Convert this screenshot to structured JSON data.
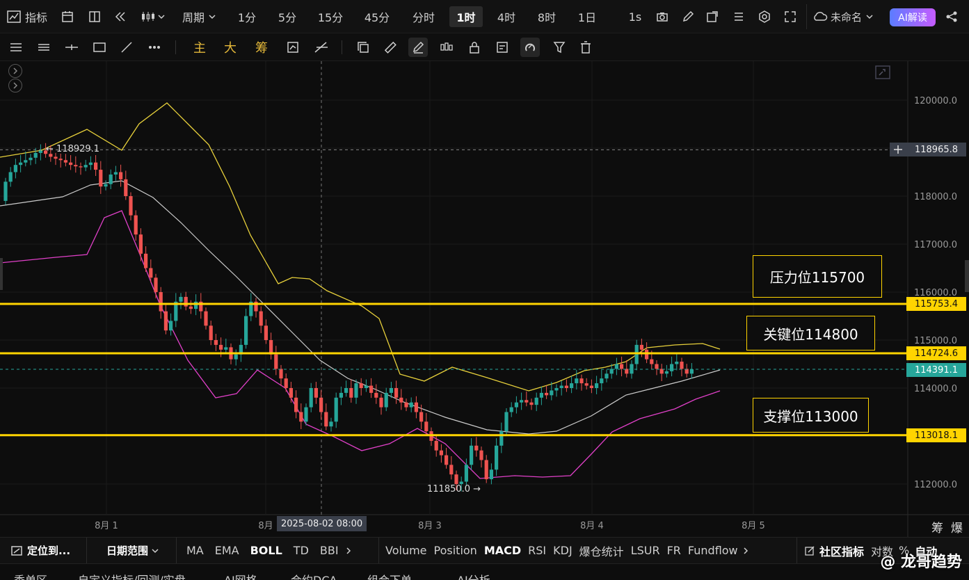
{
  "topbar": {
    "indicator_label": "指标",
    "period_label": "周期",
    "timeframes": [
      "1分",
      "5分",
      "15分",
      "45分",
      "分时",
      "1时",
      "4时",
      "8时",
      "1日"
    ],
    "active_timeframe": "1时",
    "interval_1s": "1s",
    "layout_name": "未命名",
    "ai_button": "AI解读"
  },
  "toolbar2": {
    "main_label": "主",
    "big_label": "大",
    "chip_label": "筹"
  },
  "chart": {
    "price_ticks": [
      "120000.0",
      "119000.0",
      "118000.0",
      "117000.0",
      "116000.0",
      "115000.0",
      "114000.0",
      "113000.0",
      "112000.0"
    ],
    "date_labels": [
      "8月 1",
      "8月",
      "8月 3",
      "8月 4",
      "8月 5"
    ],
    "crosshair_date": "2025-08-02 08:00",
    "crosshair_price": "118965.8",
    "high_marker": "118929.1",
    "low_marker": "111850.0",
    "level_resistance_price": "115753.4",
    "level_key_price": "114724.6",
    "level_current_price": "114391.1",
    "level_support_price": "113018.1",
    "annot_resistance": "压力位115700",
    "annot_key": "关键位114800",
    "annot_support": "支撑位113000",
    "corner_labels": [
      "筹",
      "爆"
    ],
    "colors": {
      "up": "#26a69a",
      "down": "#ef5350",
      "boll_upper": "#e8d13b",
      "boll_mid": "#cccccc",
      "boll_lower": "#e040c8",
      "level": "#ffd400"
    }
  },
  "chart_data": {
    "type": "candlestick",
    "title": "",
    "ylim": [
      111600,
      120600
    ],
    "levels": [
      115753.4,
      114724.6,
      113018.1
    ],
    "high": 118929.1,
    "low": 111850.0,
    "last": 114391.1
  },
  "bottombar": {
    "locate_label": "定位到...",
    "date_range_label": "日期范围",
    "main_indicators": [
      "MA",
      "EMA",
      "BOLL",
      "TD",
      "BBI"
    ],
    "sub_indicators": [
      "Volume",
      "Position",
      "MACD",
      "RSI",
      "KDJ",
      "爆仓统计",
      "LSUR",
      "FR",
      "Fundflow"
    ],
    "community_label": "社区指标",
    "log_label": "对数",
    "percent_label": "%",
    "auto_label": "自动"
  },
  "bottom2": {
    "items": [
      "委单区",
      "自定义指标/回测/实盘",
      "AI网格",
      "合约DCA",
      "组合下单",
      "AI分析"
    ]
  },
  "watermark": "@ 龙哥趋势"
}
